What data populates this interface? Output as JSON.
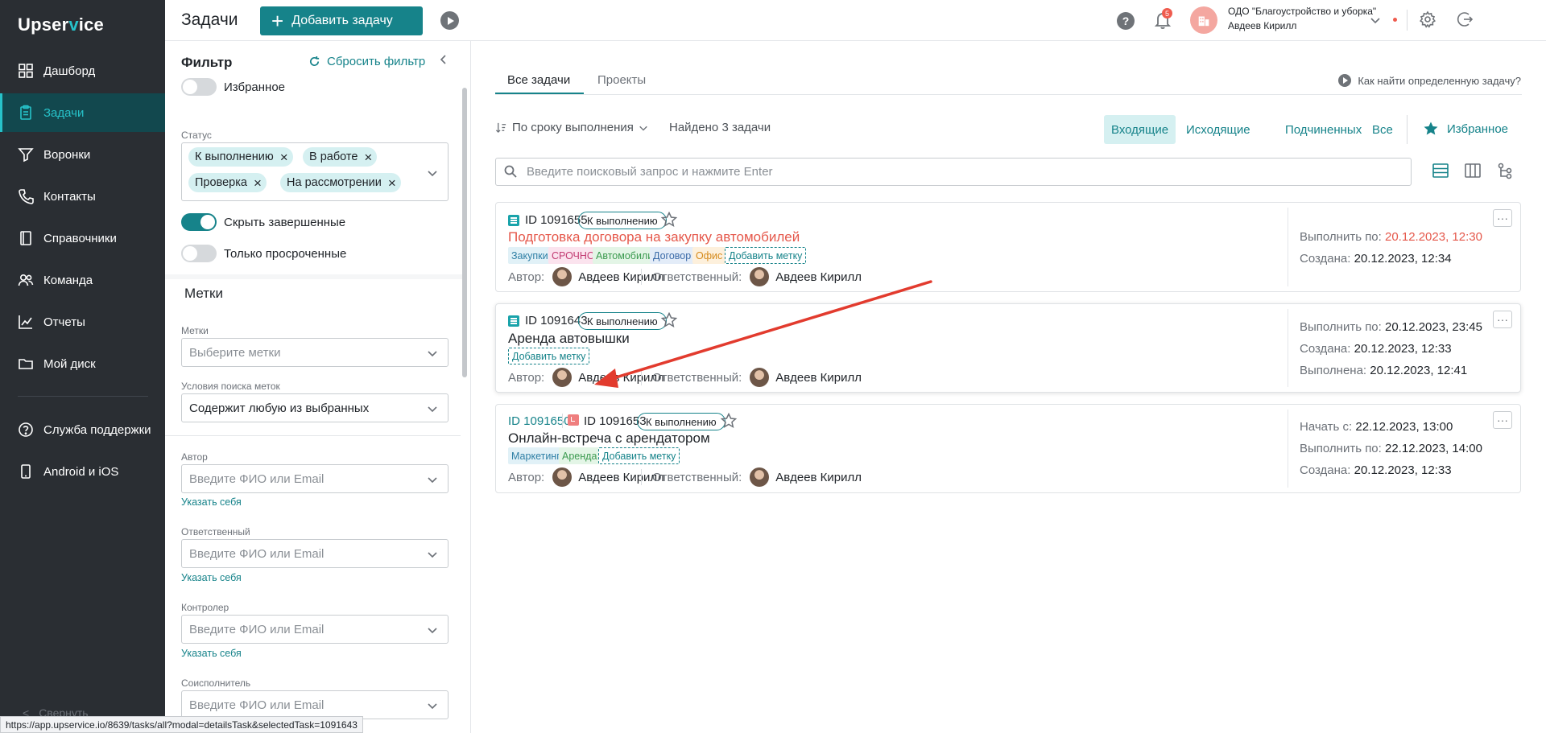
{
  "nav": {
    "logo_a": "Upser",
    "logo_b": "v",
    "logo_c": "ice",
    "items": [
      {
        "label": "Дашборд",
        "icon": "dashboard-icon"
      },
      {
        "label": "Задачи",
        "icon": "tasks-icon",
        "active": true
      },
      {
        "label": "Воронки",
        "icon": "funnel-icon"
      },
      {
        "label": "Контакты",
        "icon": "phone-icon"
      },
      {
        "label": "Справочники",
        "icon": "book-icon"
      },
      {
        "label": "Команда",
        "icon": "team-icon"
      },
      {
        "label": "Отчеты",
        "icon": "chart-icon"
      },
      {
        "label": "Мой диск",
        "icon": "folder-icon"
      }
    ],
    "support": "Служба поддержки",
    "mobile": "Android и iOS",
    "collapse": "Свернуть"
  },
  "header": {
    "title": "Задачи",
    "add_button": "Добавить задачу",
    "notifications_count": "5",
    "org_name": "ОДО \"Благоустройство и уборка\"",
    "user_name": "Авдеев Кирилл",
    "help": "?"
  },
  "filter": {
    "title": "Фильтр",
    "reset": "Сбросить фильтр",
    "favorites": "Избранное",
    "status_label": "Статус",
    "status_chips": [
      "К выполнению",
      "В работе",
      "Проверка",
      "На рассмотрении"
    ],
    "hide_completed": "Скрыть завершенные",
    "only_overdue": "Только просроченные",
    "tags_section": "Метки",
    "tags_label": "Метки",
    "tags_placeholder": "Выберите метки",
    "tag_cond_label": "Условия поиска меток",
    "tag_cond_value": "Содержит любую из выбранных",
    "author_label": "Автор",
    "person_placeholder": "Введите ФИО или Email",
    "set_me": "Указать себя",
    "responsible_label": "Ответственный",
    "controller_label": "Контролер",
    "coexecutor_label": "Соисполнитель"
  },
  "statusbar": {
    "url": "https://app.upservice.io/8639/tasks/all?modal=detailsTask&selectedTask=1091643"
  },
  "main": {
    "tabs": [
      "Все задачи",
      "Проекты"
    ],
    "howto": "Как найти определенную задачу?",
    "sort": "По сроку выполнения",
    "found": "Найдено 3 задачи",
    "segments": [
      "Входящие",
      "Исходящие",
      "Подчиненных",
      "Все"
    ],
    "favorites": "Избранное",
    "search_placeholder": "Введите поисковый запрос и нажмите Enter",
    "author_label": "Автор:",
    "responsible_label": "Ответственный:",
    "add_tag": "Добавить метку",
    "more": "···"
  },
  "tasks": [
    {
      "id": "ID 1091655",
      "status": "К выполнению",
      "title": "Подготовка договора на закупку автомобилей",
      "urgent": true,
      "tags": [
        {
          "label": "Закупки",
          "bg": "#e1f1f7",
          "fg": "#2e7fa5"
        },
        {
          "label": "СРОЧНО",
          "bg": "#fbe3ee",
          "fg": "#c23b72"
        },
        {
          "label": "Автомобили",
          "bg": "#e3f5e6",
          "fg": "#3b9a4f"
        },
        {
          "label": "Договор",
          "bg": "#e3ecf8",
          "fg": "#3a6aa8"
        },
        {
          "label": "Офис",
          "bg": "#fdf0dc",
          "fg": "#d58a1c"
        }
      ],
      "author": "Авдеев Кирилл",
      "responsible": "Авдеев Кирилл",
      "due_label": "Выполнить по:",
      "due_value": "20.12.2023, 12:30",
      "created_label": "Создана:",
      "created_value": "20.12.2023, 12:34"
    },
    {
      "id": "ID 1091643",
      "status": "К выполнению",
      "title": "Аренда автовышки",
      "author": "Авдеев Кирилл",
      "responsible": "Авдеев Кирилл",
      "due_label": "Выполнить по:",
      "due_value": "20.12.2023, 23:45",
      "created_label": "Создана:",
      "created_value": "20.12.2023, 12:33",
      "done_label": "Выполнена:",
      "done_value": "20.12.2023, 12:41"
    },
    {
      "parent_id": "ID 1091650",
      "id": "ID 1091653",
      "status": "К выполнению",
      "title": "Онлайн-встреча с арендатором",
      "tags": [
        {
          "label": "Маркетинг",
          "bg": "#e1f1f7",
          "fg": "#2e7fa5"
        },
        {
          "label": "Аренда",
          "bg": "#e3f5e6",
          "fg": "#3b9a4f"
        }
      ],
      "author": "Авдеев Кирилл",
      "responsible": "Авдеев Кирилл",
      "start_label": "Начать с:",
      "start_value": "22.12.2023, 13:00",
      "due_label": "Выполнить по:",
      "due_value": "22.12.2023, 14:00",
      "created_label": "Создана:",
      "created_value": "20.12.2023, 12:33"
    }
  ],
  "colors": {
    "accent": "#16838a",
    "nav_bg": "#2a2e33",
    "urgent": "#e5574a",
    "annotation_arrow": "#e23b2e"
  }
}
